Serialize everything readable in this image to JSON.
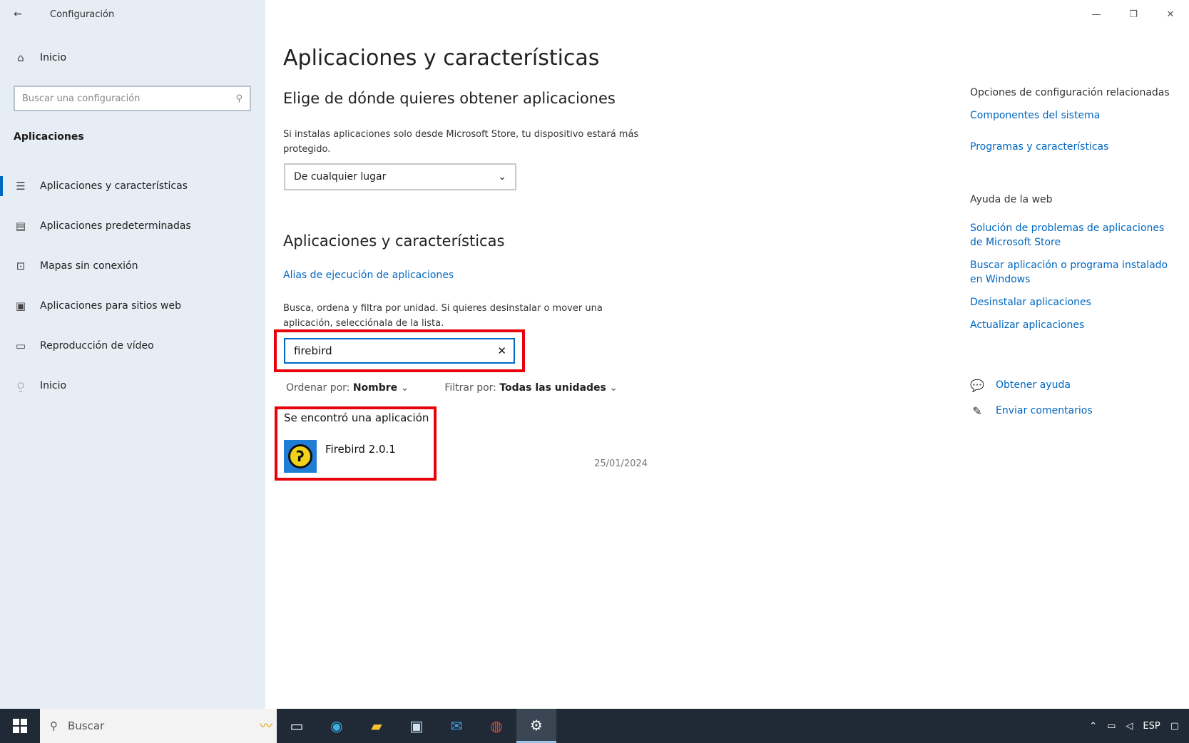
{
  "window": {
    "title": "Configuración",
    "back_icon": "←",
    "controls": {
      "minimize": "—",
      "maximize": "❐",
      "close": "✕"
    }
  },
  "sidebar": {
    "home_label": "Inicio",
    "search_placeholder": "Buscar una configuración",
    "section_title": "Aplicaciones",
    "items": [
      {
        "icon": "apps-list-icon",
        "glyph": "☰",
        "label": "Aplicaciones y características",
        "active": true
      },
      {
        "icon": "default-apps-icon",
        "glyph": "▤",
        "label": "Aplicaciones predeterminadas",
        "active": false
      },
      {
        "icon": "offline-maps-icon",
        "glyph": "⊡",
        "label": "Mapas sin conexión",
        "active": false
      },
      {
        "icon": "websites-apps-icon",
        "glyph": "▣",
        "label": "Aplicaciones para sitios web",
        "active": false
      },
      {
        "icon": "video-playback-icon",
        "glyph": "▭",
        "label": "Reproducción de vídeo",
        "active": false
      },
      {
        "icon": "startup-icon",
        "glyph": "⍜",
        "label": "Inicio",
        "active": false
      }
    ]
  },
  "main": {
    "title": "Aplicaciones y características",
    "source_heading": "Elige de dónde quieres obtener aplicaciones",
    "source_desc": "Si instalas aplicaciones solo desde Microsoft Store, tu dispositivo estará más protegido.",
    "source_dropdown_value": "De cualquier lugar",
    "apps_heading": "Aplicaciones y características",
    "aliases_link": "Alias de ejecución de aplicaciones",
    "search_desc": "Busca, ordena y filtra por unidad. Si quieres desinstalar o mover una aplicación, selecciónala de la lista.",
    "search_value": "firebird",
    "sort_label": "Ordenar por:",
    "sort_value": "Nombre",
    "filter_label": "Filtrar por:",
    "filter_value": "Todas las unidades",
    "result_count": "Se encontró una aplicación",
    "apps": [
      {
        "name": "Firebird 2.0.1",
        "date": "25/01/2024"
      }
    ]
  },
  "right_panel": {
    "related_heading": "Opciones de configuración relacionadas",
    "related_links": [
      "Componentes del sistema",
      "Programas y características"
    ],
    "web_help_heading": "Ayuda de la web",
    "web_help_links": [
      "Solución de problemas de aplicaciones de Microsoft Store",
      "Buscar aplicación o programa instalado en Windows",
      "Desinstalar aplicaciones",
      "Actualizar aplicaciones"
    ],
    "get_help": "Obtener ayuda",
    "feedback": "Enviar comentarios"
  },
  "taskbar": {
    "search_placeholder": "Buscar",
    "icons": [
      "task-view-icon",
      "edge-icon",
      "file-explorer-icon",
      "store-icon",
      "mail-icon",
      "chrome-icon",
      "settings-icon"
    ],
    "tray_lang": "ESP"
  },
  "colors": {
    "accent": "#0067c0",
    "highlight": "#e8000b",
    "sidebar": "#e6edf4",
    "taskbar": "#1f2a36"
  }
}
